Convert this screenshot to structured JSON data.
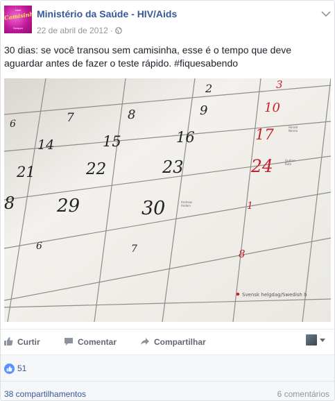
{
  "post": {
    "page_name": "Ministério da Saúde - HIV/Aids",
    "date": "22 de abril de 2012",
    "separator": "·",
    "text": "30 dias: se você transou sem camisinha, esse é o tempo que deve aguardar antes de fazer o teste rápido. #fiquesabendo",
    "avatar": {
      "line1": "Usar",
      "line2": "Camisinha",
      "line3": "É",
      "line4": "Sempre",
      "brand_color": "#c2189a"
    }
  },
  "photo": {
    "calendar_numbers": [
      "2",
      "3",
      "6",
      "7",
      "8",
      "9",
      "10",
      "14",
      "15",
      "16",
      "17",
      "21",
      "22",
      "23",
      "24",
      "29",
      "30",
      "1",
      "6",
      "7",
      "8"
    ],
    "footer_text": "Svensk helgdag/Swedish h",
    "small_notes": [
      "Andreas",
      "Anders",
      "Gudrun",
      "Rutn",
      "Harald",
      "Nanna"
    ]
  },
  "actions": {
    "like_label": "Curtir",
    "comment_label": "Comentar",
    "share_label": "Compartilhar"
  },
  "reactions": {
    "like_count": "51"
  },
  "footer": {
    "shares": "38 compartilhamentos",
    "comments": "6 comentários"
  },
  "colors": {
    "link": "#365899",
    "muted": "#90949c",
    "like_blue": "#5890ff",
    "calendar_red": "#c8202a"
  }
}
